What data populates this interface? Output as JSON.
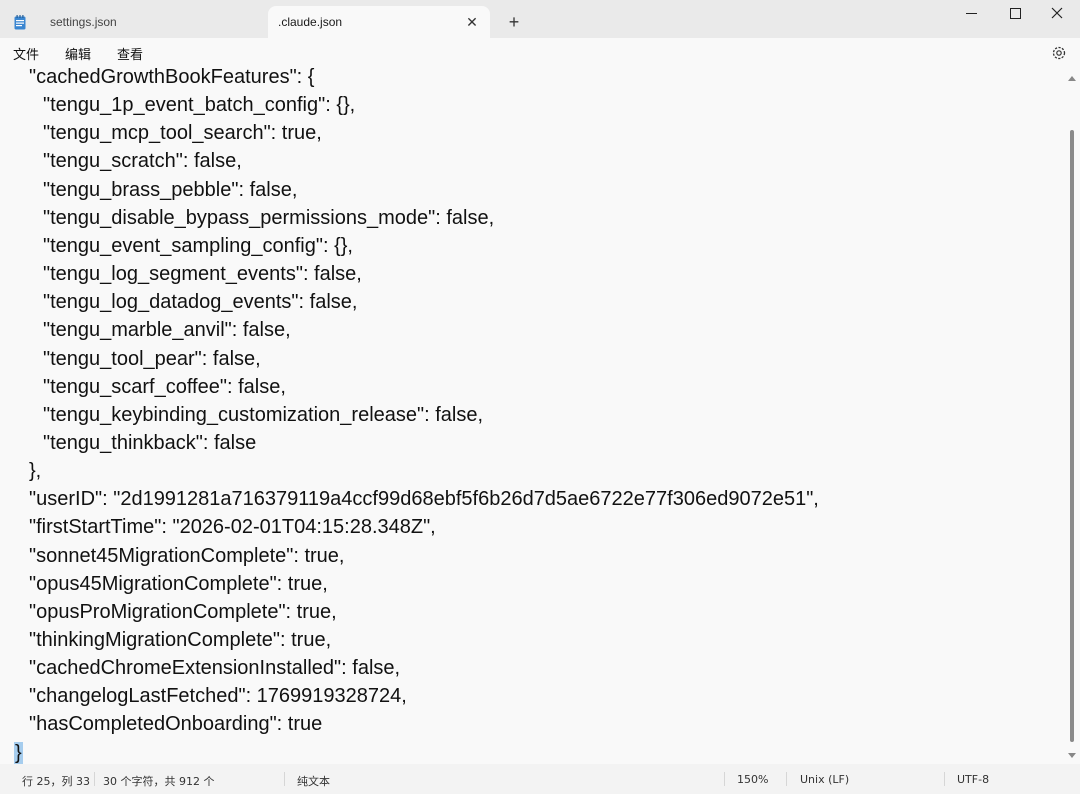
{
  "tabs": [
    {
      "label": "settings.json",
      "active": false
    },
    {
      "label": ".claude.json",
      "active": true
    }
  ],
  "menu": {
    "file": "文件",
    "edit": "编辑",
    "view": "查看"
  },
  "editor": {
    "lines": [
      "  \"cachedGrowthBookFeatures\": {",
      "    \"tengu_1p_event_batch_config\": {},",
      "    \"tengu_mcp_tool_search\": true,",
      "    \"tengu_scratch\": false,",
      "    \"tengu_brass_pebble\": false,",
      "    \"tengu_disable_bypass_permissions_mode\": false,",
      "    \"tengu_event_sampling_config\": {},",
      "    \"tengu_log_segment_events\": false,",
      "    \"tengu_log_datadog_events\": false,",
      "    \"tengu_marble_anvil\": false,",
      "    \"tengu_tool_pear\": false,",
      "    \"tengu_scarf_coffee\": false,",
      "    \"tengu_keybinding_customization_release\": false,",
      "    \"tengu_thinkback\": false",
      "  },",
      "  \"userID\": \"2d1991281a716379119a4ccf99d68ebf5f6b26d7d5ae6722e77f306ed9072e51\",",
      "  \"firstStartTime\": \"2026-02-01T04:15:28.348Z\",",
      "  \"sonnet45MigrationComplete\": true,",
      "  \"opus45MigrationComplete\": true,",
      "  \"opusProMigrationComplete\": true,",
      "  \"thinkingMigrationComplete\": true,",
      "  \"cachedChromeExtensionInstalled\": false,",
      "  \"changelogLastFetched\": 1769919328724,",
      "  \"hasCompletedOnboarding\": true",
      "}"
    ],
    "selected_line": 24
  },
  "status": {
    "position": "行 25，列 33",
    "chars": "30 个字符，共 912 个",
    "format": "纯文本",
    "zoom": "150%",
    "line_ending": "Unix (LF)",
    "encoding": "UTF-8"
  }
}
